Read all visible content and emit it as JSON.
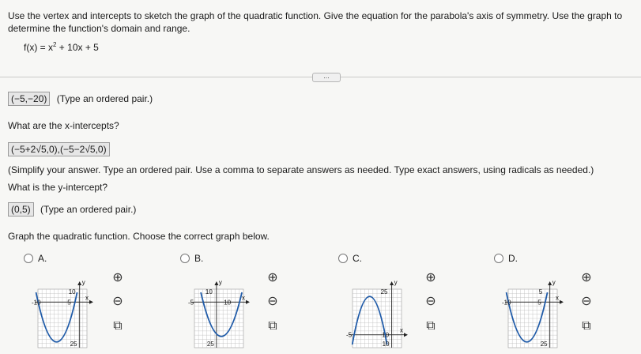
{
  "problem": {
    "instruction": "Use the vertex and intercepts to sketch the graph of the quadratic function. Give the equation for the parabola's axis of symmetry. Use the graph to determine the function's domain and range.",
    "function_lhs": "f(x) = x",
    "function_exp": "2",
    "function_rhs": " + 10x + 5",
    "more_label": "..."
  },
  "vertex": {
    "answer": "(−5,−20)",
    "note": "(Type an ordered pair.)"
  },
  "x_intercepts": {
    "question": "What are the x-intercepts?",
    "answer": "(−5+2√5,0),(−5−2√5,0)",
    "note": "(Simplify your answer. Type an ordered pair. Use a comma to separate answers as needed. Type exact answers, using radicals as needed.)"
  },
  "y_intercept": {
    "question": "What is the y-intercept?",
    "answer": "(0,5)",
    "note": "(Type an ordered pair.)"
  },
  "graph_choice": {
    "prompt": "Graph the quadratic function. Choose the correct graph below.",
    "options": [
      {
        "label": "A.",
        "t1": "10",
        "t2": "-10",
        "t3": "5",
        "t4": "25",
        "ylabel": "y",
        "xlabel": "x"
      },
      {
        "label": "B.",
        "t1": "10",
        "t2": "-5",
        "t3": "10",
        "t4": "25",
        "ylabel": "y",
        "xlabel": "x"
      },
      {
        "label": "C.",
        "t1": "25",
        "t2": "-5",
        "t3": "10",
        "t4": "10",
        "ylabel": "y",
        "xlabel": "x"
      },
      {
        "label": "D.",
        "t1": "5",
        "t2": "-10",
        "t3": "5",
        "t4": "25",
        "ylabel": "y",
        "xlabel": "x"
      }
    ]
  },
  "colors": {
    "curve": "#1e5aa8",
    "accent": "#2a6fb5",
    "answer_bg": "#e6e6e6"
  }
}
